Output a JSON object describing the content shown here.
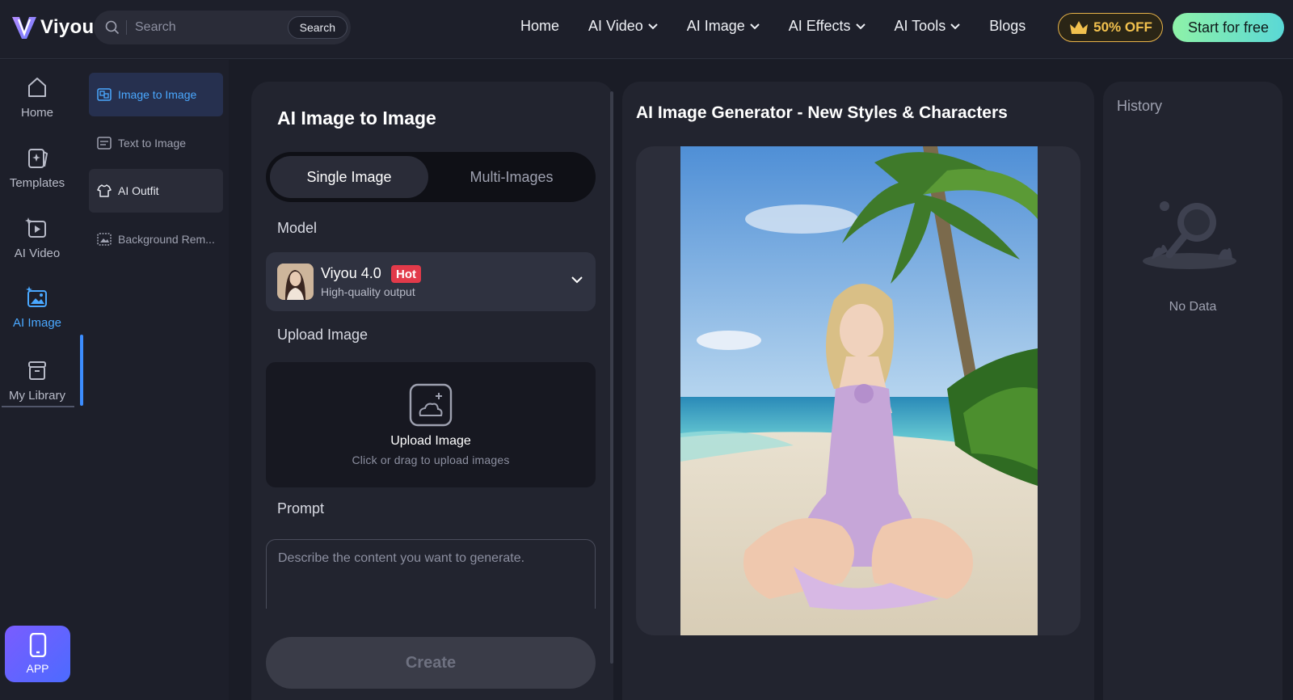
{
  "header": {
    "logo_text": "Viyou",
    "search_placeholder": "Search",
    "search_button": "Search",
    "nav": [
      {
        "label": "Home"
      },
      {
        "label": "AI Video"
      },
      {
        "label": "AI Image"
      },
      {
        "label": "AI Effects"
      },
      {
        "label": "AI Tools"
      },
      {
        "label": "Blogs"
      }
    ],
    "offer_label": "50% OFF",
    "start_label": "Start for free"
  },
  "rail": {
    "items": [
      {
        "label": "Home",
        "icon": "home-icon"
      },
      {
        "label": "Templates",
        "icon": "templates-icon"
      },
      {
        "label": "AI Video",
        "icon": "video-icon"
      },
      {
        "label": "AI Image",
        "icon": "image-icon",
        "active": true
      },
      {
        "label": "My Library",
        "icon": "library-icon"
      }
    ],
    "app_label": "APP"
  },
  "submenu": {
    "items": [
      {
        "label": "Image to Image",
        "active": true
      },
      {
        "label": "Text to Image"
      },
      {
        "label": "AI Outfit"
      },
      {
        "label": "Background Rem..."
      }
    ]
  },
  "form": {
    "title": "AI Image to Image",
    "tabs": [
      "Single Image",
      "Multi-Images"
    ],
    "model_label": "Model",
    "model_name": "Viyou 4.0",
    "model_badge": "Hot",
    "model_sub": "High-quality output",
    "upload_label": "Upload Image",
    "upload_title": "Upload Image",
    "upload_sub": "Click or drag to upload images",
    "prompt_label": "Prompt",
    "prompt_placeholder": "Describe the content you want to generate.",
    "create_label": "Create"
  },
  "preview": {
    "title": "AI Image Generator - New Styles & Characters"
  },
  "history": {
    "title": "History",
    "empty_text": "No Data"
  },
  "colors": {
    "accent": "#4aa8ff",
    "offer": "#f2c14e",
    "hot": "#e23a4a",
    "start_gradient": [
      "#8ef2a8",
      "#5ad8d6"
    ]
  }
}
